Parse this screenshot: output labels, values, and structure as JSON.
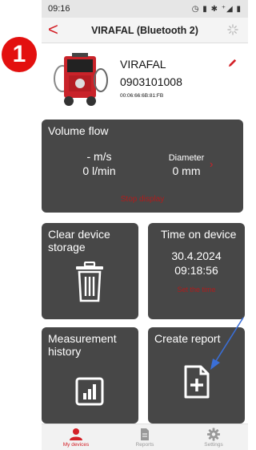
{
  "status_bar": {
    "time": "09:16",
    "icons": "◷ ▮ ✱ ⁺◢ ▮"
  },
  "header": {
    "back_glyph": "<",
    "title": "VIRAFAL (Bluetooth 2)"
  },
  "step_badge": "1",
  "device": {
    "name": "VIRAFAL",
    "serial": "0903101008",
    "mac": "00:06:66:6B:81:FB"
  },
  "volume_flow": {
    "title": "Volume flow",
    "velocity": "- m/s",
    "flow": "0 l/min",
    "diameter_label": "Diameter",
    "diameter_value": "0 mm",
    "stop_display": "Stop display"
  },
  "clear_storage": {
    "title": "Clear device storage"
  },
  "time_on_device": {
    "title": "Time on device",
    "date": "30.4.2024",
    "time": "09:18:56",
    "set_time": "Set the time"
  },
  "measurement_history": {
    "title": "Measurement history"
  },
  "create_report": {
    "title": "Create report"
  },
  "bottom_nav": {
    "items": [
      {
        "label": "My devices",
        "icon": "person-icon",
        "active": true
      },
      {
        "label": "Reports",
        "icon": "document-icon",
        "active": false
      },
      {
        "label": "Settings",
        "icon": "gear-icon",
        "active": false
      }
    ]
  },
  "colors": {
    "accent": "#d32027",
    "card": "#474747",
    "badge": "#e3100f",
    "arrow": "#3a6fd8"
  }
}
